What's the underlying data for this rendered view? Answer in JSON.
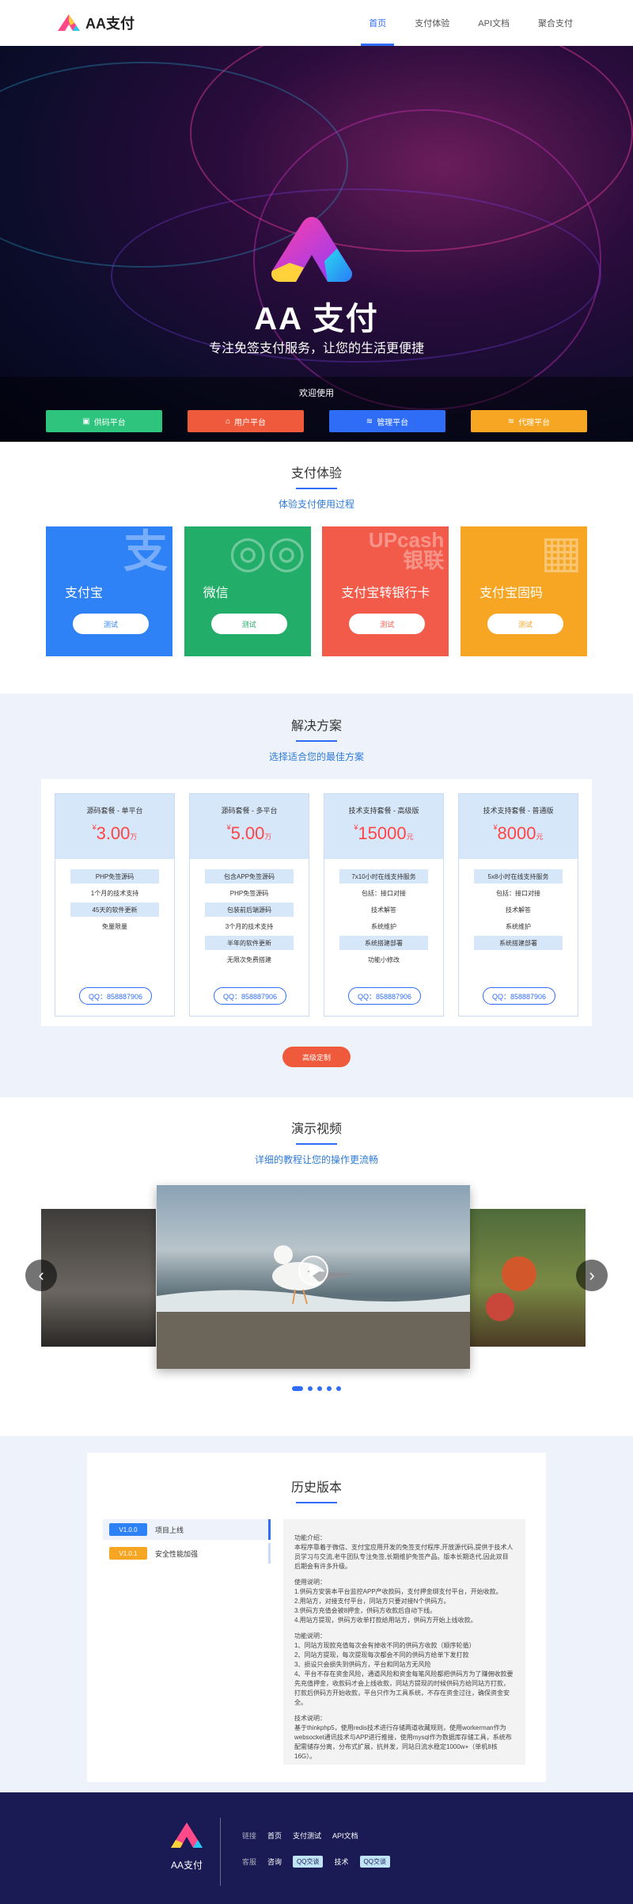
{
  "brand": {
    "name": "AA支付"
  },
  "nav": {
    "items": [
      "首页",
      "支付体验",
      "API文档",
      "聚合支付"
    ]
  },
  "hero": {
    "title": "AA 支付",
    "subtitle": "专注免签支付服务，让您的生活更便捷",
    "welcome": "欢迎使用",
    "buttons": [
      {
        "label": "供码平台",
        "color": "#2ec47e"
      },
      {
        "label": "用户平台",
        "color": "#f05a3c"
      },
      {
        "label": "管理平台",
        "color": "#2f6df6"
      },
      {
        "label": "代理平台",
        "color": "#f6a623"
      }
    ]
  },
  "pay": {
    "title": "支付体验",
    "subtitle": "体验支付使用过程",
    "cards": [
      {
        "name": "支付宝",
        "bg": "支",
        "btn": "测试",
        "color": "#2f82f6"
      },
      {
        "name": "微信",
        "bg": "◎◎",
        "btn": "测试",
        "color": "#22ad68"
      },
      {
        "name": "支付宝转银行卡",
        "bg": "UPcash 银联",
        "btn": "测试",
        "color": "#f25a4a"
      },
      {
        "name": "支付宝固码",
        "bg": "▦",
        "btn": "测试",
        "color": "#f6a623"
      }
    ]
  },
  "solutions": {
    "title": "解决方案",
    "subtitle": "选择适合您的最佳方案",
    "plans": [
      {
        "name": "源码套餐 - 单平台",
        "currency": "¥",
        "price": "3.00",
        "unit": "万",
        "features": [
          "PHP免签源码",
          "1个月的技术支持",
          "45天的软件更新",
          "免量限量"
        ],
        "qq": "QQ：858887906"
      },
      {
        "name": "源码套餐 - 多平台",
        "currency": "¥",
        "price": "5.00",
        "unit": "万",
        "features": [
          "包含APP免签源码",
          "PHP免签源码",
          "包装前后端源码",
          "3个月的技术支持",
          "半年的软件更新",
          "无限次免费搭建"
        ],
        "qq": "QQ：858887906"
      },
      {
        "name": "技术支持套餐 - 高级版",
        "currency": "¥",
        "price": "15000",
        "unit": "元",
        "features": [
          "7x10小时在线支持服务",
          "包括：接口对接",
          "技术解答",
          "系统维护",
          "系统搭建部署",
          "功能小修改"
        ],
        "qq": "QQ：858887906"
      },
      {
        "name": "技术支持套餐 - 普通版",
        "currency": "¥",
        "price": "8000",
        "unit": "元",
        "features": [
          "5x8小时在线支持服务",
          "包括：接口对接",
          "技术解答",
          "系统维护",
          "系统搭建部署"
        ],
        "qq": "QQ：858887906"
      }
    ],
    "custom_btn": "高级定制"
  },
  "video": {
    "title": "演示视频",
    "subtitle": "详细的教程让您的操作更流畅",
    "slide_count": 5,
    "active_slide": 1
  },
  "history": {
    "title": "历史版本",
    "versions": [
      {
        "ver": "V1.0.0",
        "label": "项目上线",
        "color": "#2f82f6"
      },
      {
        "ver": "V1.0.1",
        "label": "安全性能加强",
        "color": "#f6a623"
      }
    ],
    "desc": {
      "intro_title": "功能介绍：",
      "intro": "本程序靠着于微信、支付宝应用开发的免签支付程序,开放源代码,提供于技术人员学习与交流,老牛团队专注免签,长期维护免签产品。版本长期迭代,因此双目后期会有许多升级。",
      "usage_title": "使用说明：",
      "usage": [
        "1.供码方安装本平台监控APP产收款码，支付押金绑支付平台，开始收款。",
        "2.用站方，对接支付平台，同站方只要对接N个供码方。",
        "3.供码方充值会被8押金，供码方收款后自动下线。",
        "4.用站方提现，供码方收单打款给用站方，供码方开始上线收款。"
      ],
      "func_title": "功能说明：",
      "funcs": [
        "1、同站方现款充值每次会有掉收不同的供码方收款（顺序轮循）",
        "2、同站方提现，每次提现每次都会不同的供码方给单下发打款",
        "3、损设只会损失到供码方，平台和同站方无风险",
        "4、平台不存在资金风险，通道风险和资金每笔风险都把供码方为了赚佣收款要先充值押金，收款码才会上线收款，同站方提现的时候供码方给同站方打款，打款后供码方开始收款，平台只作为工具系统，不存在资金过往，确保资金安全。"
      ],
      "tech_title": "技术说明：",
      "tech": "基于thinkphp5，使用redis技术进行存储两道收藏规则，使用workerman作为websocket通讯技术与APP进行推接，使用mysql作为数据库存储工具，系统布配需储存分离，分布式扩展，抗并发，同站日流水稳定1000w+（单机8核16G）。"
    }
  },
  "footer": {
    "brand": "AA支付",
    "row1": {
      "label": "链接",
      "links": [
        "首页",
        "支付测试",
        "API文档"
      ]
    },
    "row2": {
      "label": "客服",
      "links": [
        "咨询",
        "QQ交谈",
        "技术",
        "QQ交谈"
      ]
    }
  }
}
